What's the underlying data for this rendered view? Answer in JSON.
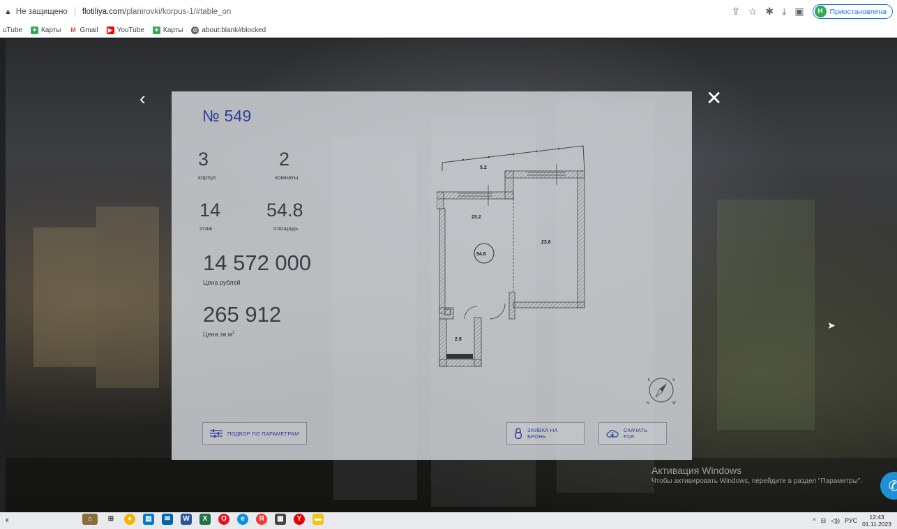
{
  "browser": {
    "security_label": "Не защищено",
    "url_host": "flotiliya.com",
    "url_path": "/planirovki/korpus-1/#table_on",
    "profile_label": "Приостановлена",
    "profile_initial": "Н",
    "bookmarks": [
      {
        "label": "uTube",
        "icon": "youtube-partial-icon",
        "color": "#ff0000"
      },
      {
        "label": "Карты",
        "icon": "maps-icon",
        "color": "#34a853"
      },
      {
        "label": "Gmail",
        "icon": "gmail-icon",
        "color": "#ea4335"
      },
      {
        "label": "YouTube",
        "icon": "youtube-icon",
        "color": "#ff0000"
      },
      {
        "label": "Карты",
        "icon": "maps-icon",
        "color": "#34a853"
      },
      {
        "label": "about:blank#blocked",
        "icon": "blocked-icon",
        "color": "#5f6368"
      }
    ]
  },
  "apartment": {
    "title": "№ 549",
    "building": {
      "value": "3",
      "label": "корпус"
    },
    "rooms": {
      "value": "2",
      "label": "комнаты"
    },
    "floor": {
      "value": "14",
      "label": "этаж"
    },
    "area": {
      "value": "54.8",
      "label": "площадь"
    },
    "price": {
      "value": "14 572 000",
      "label": "Цена рублей"
    },
    "price_per_m2": {
      "value": "265 912",
      "label": "Цена за м",
      "label_sup": "2"
    }
  },
  "plan": {
    "rooms": [
      "5.2",
      "23.2",
      "23.6",
      "54.8",
      "2.8"
    ],
    "compass": [
      "E",
      "S",
      "N",
      "W"
    ]
  },
  "buttons": {
    "filter": "ПОДБОР ПО ПАРАМЕТРАМ",
    "reserve": "ЗАЯВКА НА БРОНЬ",
    "pdf": "СКАЧАТЬ PDF"
  },
  "windows": {
    "activation_title": "Активация Windows",
    "activation_text": "Чтобы активировать Windows, перейдите в раздел \"Параметры\".",
    "taskbar_left": "к",
    "lang": "РУС",
    "time": "12:43",
    "date": "01.11.2023"
  },
  "colors": {
    "accent": "#2b3d9b",
    "card_bg": "#cdd0d4"
  }
}
